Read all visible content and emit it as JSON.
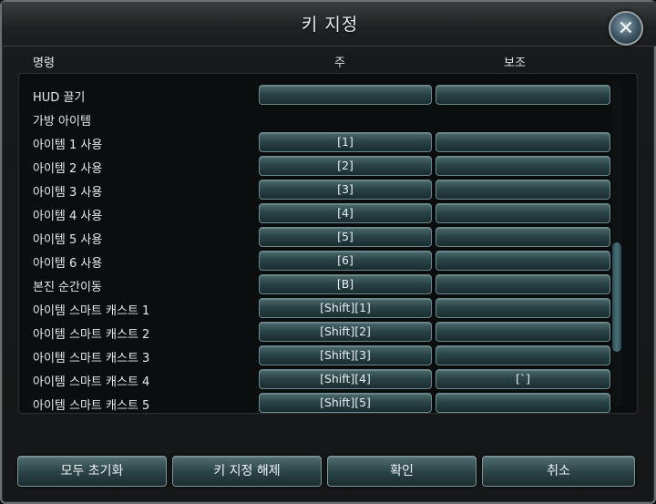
{
  "window": {
    "title": "키 지정"
  },
  "columns": {
    "command": "명령",
    "primary": "주",
    "secondary": "보조"
  },
  "rows": [
    {
      "label": "HUD 끌기",
      "primary": "",
      "secondary": "",
      "has_buttons": true
    },
    {
      "label": "가방 아이템",
      "primary": "",
      "secondary": "",
      "has_buttons": false
    },
    {
      "label": "아이템 1 사용",
      "primary": "[1]",
      "secondary": "",
      "has_buttons": true
    },
    {
      "label": "아이템 2 사용",
      "primary": "[2]",
      "secondary": "",
      "has_buttons": true
    },
    {
      "label": "아이템 3 사용",
      "primary": "[3]",
      "secondary": "",
      "has_buttons": true
    },
    {
      "label": "아이템 4 사용",
      "primary": "[4]",
      "secondary": "",
      "has_buttons": true
    },
    {
      "label": "아이템 5 사용",
      "primary": "[5]",
      "secondary": "",
      "has_buttons": true
    },
    {
      "label": "아이템 6 사용",
      "primary": "[6]",
      "secondary": "",
      "has_buttons": true
    },
    {
      "label": "본진 순간이동",
      "primary": "[B]",
      "secondary": "",
      "has_buttons": true
    },
    {
      "label": "아이템 스마트 캐스트 1",
      "primary": "[Shift][1]",
      "secondary": "",
      "has_buttons": true
    },
    {
      "label": "아이템 스마트 캐스트 2",
      "primary": "[Shift][2]",
      "secondary": "",
      "has_buttons": true
    },
    {
      "label": "아이템 스마트 캐스트 3",
      "primary": "[Shift][3]",
      "secondary": "",
      "has_buttons": true
    },
    {
      "label": "아이템 스마트 캐스트 4",
      "primary": "[Shift][4]",
      "secondary": "[`]",
      "has_buttons": true
    },
    {
      "label": "아이템 스마트 캐스트 5",
      "primary": "[Shift][5]",
      "secondary": "",
      "has_buttons": true
    }
  ],
  "buttons": {
    "reset_all": "모두 초기화",
    "unbind": "키 지정 해제",
    "confirm": "확인",
    "cancel": "취소"
  },
  "icons": {
    "close": "close-icon"
  }
}
